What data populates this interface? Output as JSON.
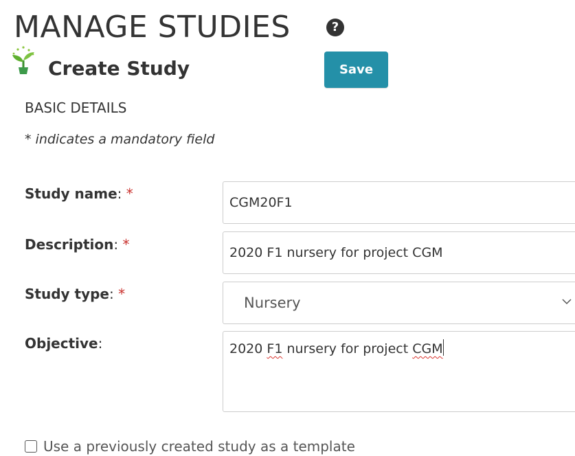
{
  "header": {
    "title": "MANAGE STUDIES",
    "help_icon": "question-circle-icon",
    "help_glyph": "?"
  },
  "section": {
    "icon": "sprout-icon",
    "title": "Create Study",
    "save_label": "Save",
    "accent_color": "#2490a8"
  },
  "form": {
    "heading": "BASIC DETAILS",
    "mandatory_note": "* indicates a mandatory field",
    "required_marker": "*",
    "required_color": "#c9302c",
    "fields": {
      "study_name": {
        "label": "Study name",
        "value": "CGM20F1",
        "required": true
      },
      "description": {
        "label": "Description",
        "value": "2020 F1 nursery for project CGM",
        "required": true
      },
      "study_type": {
        "label": "Study type",
        "value": "Nursery",
        "required": true
      },
      "objective": {
        "label": "Objective",
        "required": false,
        "value_part1": "2020 ",
        "value_part2": "F1",
        "value_part3": " nursery for project ",
        "value_part4": "CGM"
      }
    },
    "template_checkbox": {
      "label": "Use a previously created study as a template",
      "checked": false
    }
  }
}
